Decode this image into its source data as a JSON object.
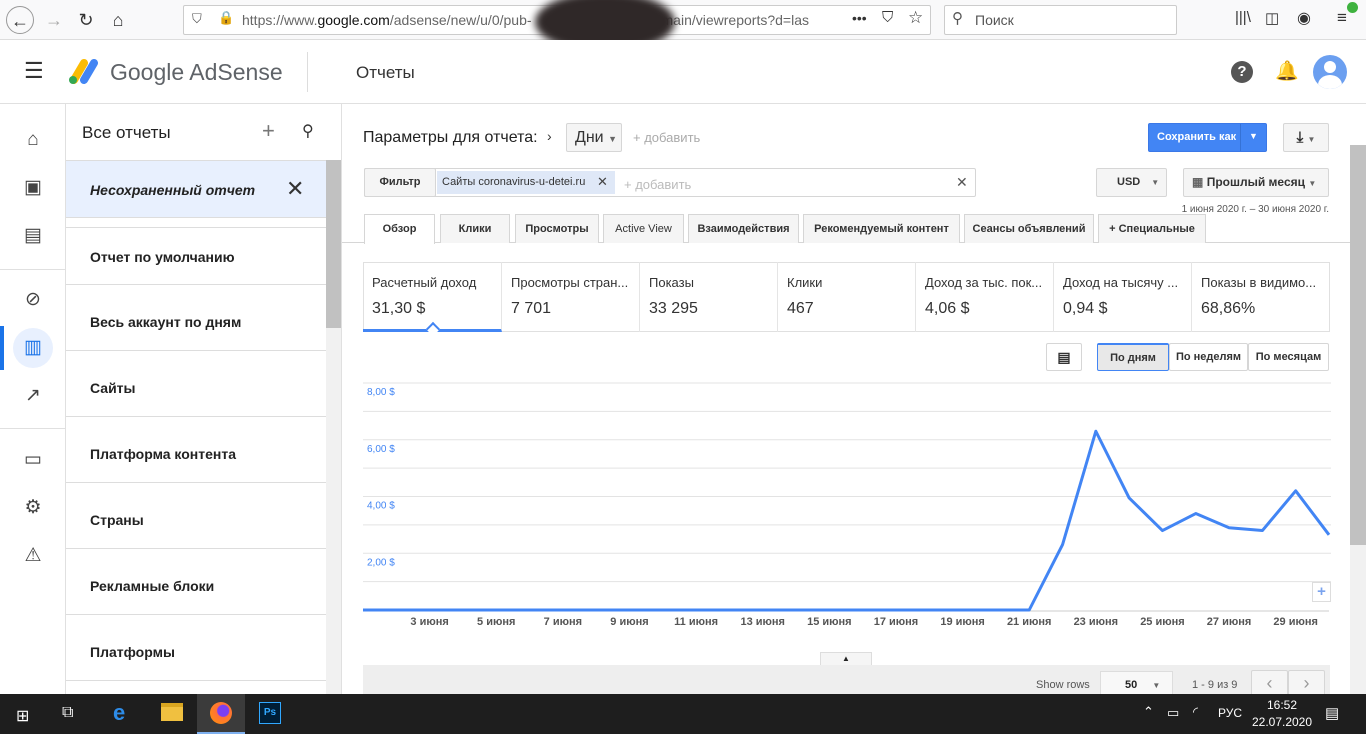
{
  "browser": {
    "url_prefix": "https://www.",
    "url_domain": "google.com",
    "url_path": "/adsense/new/u/0/pub-",
    "url_suffix": "main/viewreports?d=las",
    "search_placeholder": "Поиск"
  },
  "app": {
    "logo": "Google AdSense",
    "section": "Отчеты"
  },
  "reports_panel": {
    "title": "Все отчеты",
    "items": [
      {
        "label": "Несохраненный отчет"
      },
      {
        "label": "Отчет по умолчанию"
      },
      {
        "label": "Весь аккаунт по дням"
      },
      {
        "label": "Сайты"
      },
      {
        "label": "Платформа контента"
      },
      {
        "label": "Страны"
      },
      {
        "label": "Рекламные блоки"
      },
      {
        "label": "Платформы"
      }
    ]
  },
  "params": {
    "label": "Параметры для отчета:",
    "dimension": "Дни",
    "add": "+ добавить",
    "save_as": "Сохранить как"
  },
  "filter": {
    "label": "Фильтр",
    "chip": "Сайты coronavirus-u-detei.ru",
    "add": "+ добавить"
  },
  "currency": "USD",
  "period": "Прошлый месяц",
  "date_range": "1 июня 2020 г. – 30 июня 2020 г.",
  "tabs": [
    "Обзор",
    "Клики",
    "Просмотры",
    "Active View",
    "Взаимодействия",
    "Рекомендуемый контент",
    "Сеансы объявлений",
    "+ Специальные"
  ],
  "metrics": [
    {
      "label": "Расчетный доход",
      "value": "31,30 $"
    },
    {
      "label": "Просмотры стран...",
      "value": "7 701"
    },
    {
      "label": "Показы",
      "value": "33 295"
    },
    {
      "label": "Клики",
      "value": "467"
    },
    {
      "label": "Доход за тыс. пок...",
      "value": "4,06 $"
    },
    {
      "label": "Доход на тысячу ...",
      "value": "0,94 $"
    },
    {
      "label": "Показы в видимо...",
      "value": "68,86%"
    }
  ],
  "granularity": [
    "По дням",
    "По неделям",
    "По месяцам"
  ],
  "chart_data": {
    "type": "line",
    "title": "",
    "xlabel": "",
    "ylabel": "Расчетный доход",
    "ylim": [
      0,
      8
    ],
    "y_ticks": [
      "2,00 $",
      "4,00 $",
      "6,00 $",
      "8,00 $"
    ],
    "x_tick_labels": [
      "3 июня",
      "5 июня",
      "7 июня",
      "9 июня",
      "11 июня",
      "13 июня",
      "15 июня",
      "17 июня",
      "19 июня",
      "21 июня",
      "23 июня",
      "25 июня",
      "27 июня",
      "29 июня"
    ],
    "x": [
      1,
      2,
      3,
      4,
      5,
      6,
      7,
      8,
      9,
      10,
      11,
      12,
      13,
      14,
      15,
      16,
      17,
      18,
      19,
      20,
      21,
      22,
      23,
      24,
      25,
      26,
      27,
      28,
      29,
      30
    ],
    "series": [
      {
        "name": "Расчетный доход",
        "color": "#4285f4",
        "values": [
          0,
          0,
          0,
          0,
          0,
          0,
          0,
          0,
          0,
          0,
          0,
          0,
          0,
          0,
          0,
          0,
          0,
          0,
          0,
          0,
          0,
          2.3,
          6.3,
          3.95,
          2.8,
          3.4,
          2.9,
          2.8,
          4.2,
          2.65
        ]
      }
    ]
  },
  "table": {
    "show_rows_label": "Show rows",
    "rows": "50",
    "range": "1 - 9 из 9"
  },
  "taskbar": {
    "lang": "РУС",
    "time": "16:52",
    "date": "22.07.2020"
  }
}
